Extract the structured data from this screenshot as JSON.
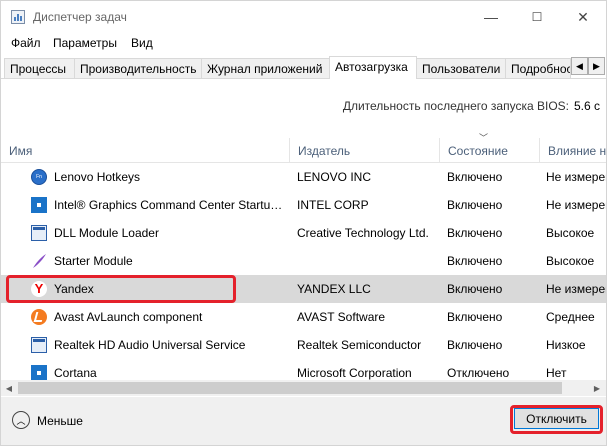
{
  "window": {
    "title": "Диспетчер задач",
    "minimize": "—",
    "maximize": "☐",
    "close": "✕"
  },
  "menu": [
    "Файл",
    "Параметры",
    "Вид"
  ],
  "tabs": [
    "Процессы",
    "Производительность",
    "Журнал приложений",
    "Автозагрузка",
    "Пользователи",
    "Подробности"
  ],
  "active_tab": "Автозагрузка",
  "bios": {
    "label": "Длительность последнего запуска BIOS:",
    "value": "5.6 с"
  },
  "columns": [
    "Имя",
    "Издатель",
    "Состояние",
    "Влияние на запуск"
  ],
  "rows": [
    {
      "name": "Lenovo Hotkeys",
      "publisher": "LENOVO INC",
      "status": "Включено",
      "impact": "Не измерено",
      "icon": "lenovo-hotkeys-icon"
    },
    {
      "name": "Intel® Graphics Command Center Startu…",
      "publisher": "INTEL CORP",
      "status": "Включено",
      "impact": "Не измерено",
      "icon": "intel-graphics-icon"
    },
    {
      "name": "DLL Module Loader",
      "publisher": "Creative Technology Ltd.",
      "status": "Включено",
      "impact": "Высокое",
      "icon": "window-app-icon"
    },
    {
      "name": "Starter Module",
      "publisher": "",
      "status": "Включено",
      "impact": "Высокое",
      "icon": "creative-feather-icon"
    },
    {
      "name": "Yandex",
      "publisher": "YANDEX LLC",
      "status": "Включено",
      "impact": "Не измерено",
      "icon": "yandex-icon"
    },
    {
      "name": "Avast AvLaunch component",
      "publisher": "AVAST Software",
      "status": "Включено",
      "impact": "Среднее",
      "icon": "avast-icon"
    },
    {
      "name": "Realtek HD Audio Universal Service",
      "publisher": "Realtek Semiconductor",
      "status": "Включено",
      "impact": "Низкое",
      "icon": "window-app-icon"
    },
    {
      "name": "Cortana",
      "publisher": "Microsoft Corporation",
      "status": "Отключено",
      "impact": "Нет",
      "icon": "cortana-icon"
    }
  ],
  "selected_row": "Yandex",
  "footer": {
    "less_label": "Меньше",
    "disable_button": "Отключить"
  },
  "colors": {
    "highlight": "#e4212b",
    "selected_row": "#d9d9d9",
    "header_text": "#4c607a"
  }
}
